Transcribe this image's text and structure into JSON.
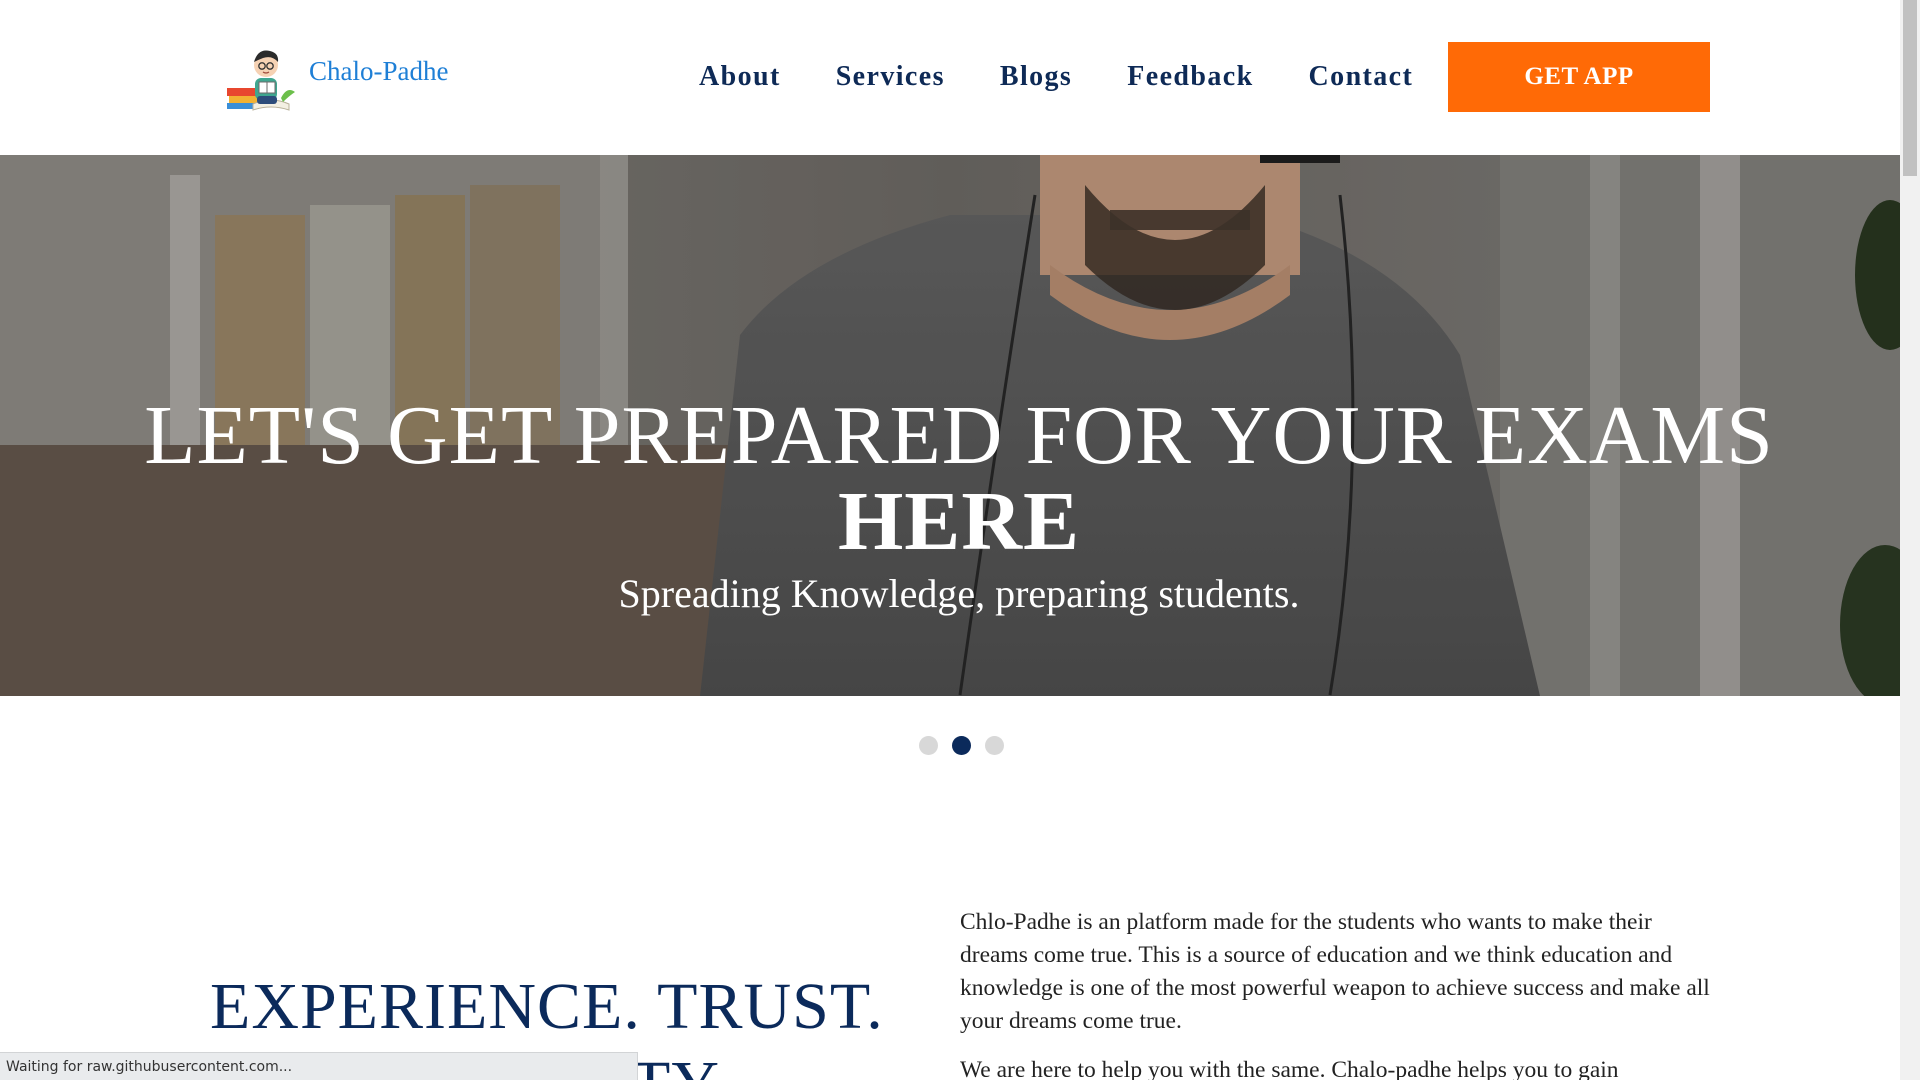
{
  "header": {
    "logo_text": "Chalo-Padhe",
    "nav": [
      "About",
      "Services",
      "Blogs",
      "Feedback",
      "Contact"
    ],
    "cta_label": "GET APP"
  },
  "hero": {
    "title_line1": "LET'S GET PREPARED FOR YOUR EXAMS",
    "title_line2": "HERE",
    "subtitle": "Spreading Knowledge, preparing students.",
    "carousel": {
      "slide_count": 3,
      "active_index": 1
    }
  },
  "about": {
    "heading_line1": "EXPERIENCE. TRUST.",
    "heading_line2": "TY",
    "paragraph1": "Chlo-Padhe is an platform made for the students who wants to make their dreams come true. This is a source of education and we think education and knowledge is one of the most powerful weapon to achieve success and make all your dreams come true.",
    "paragraph2": "We are here to help you with the same. Chalo-padhe helps you to gain"
  },
  "status_bar": {
    "text": "Waiting for raw.githubusercontent.com..."
  },
  "colors": {
    "brand_blue": "#1e7fd6",
    "navy": "#0b2a5b",
    "cta_orange": "#ff6a06"
  }
}
